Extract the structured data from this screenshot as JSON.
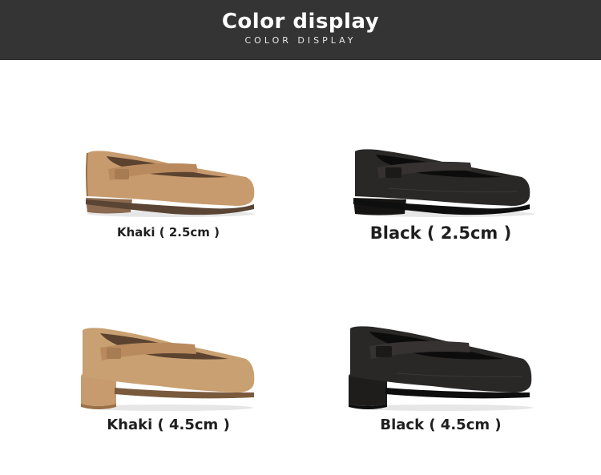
{
  "header": {
    "title": "Color display",
    "subtitle": "COLOR DISPLAY"
  },
  "colors": {
    "header_bg": "#343434",
    "khaki": "#c79b6e",
    "khaki_dark": "#9a7047",
    "black": "#2a2827",
    "black_dark": "#141313"
  },
  "products": [
    {
      "label": "Khaki ( 2.5cm )",
      "color": "khaki",
      "heel": "low"
    },
    {
      "label": "Black ( 2.5cm )",
      "color": "black",
      "heel": "low"
    },
    {
      "label": "Khaki ( 4.5cm )",
      "color": "khaki",
      "heel": "block"
    },
    {
      "label": "Black ( 4.5cm )",
      "color": "black",
      "heel": "block"
    }
  ]
}
